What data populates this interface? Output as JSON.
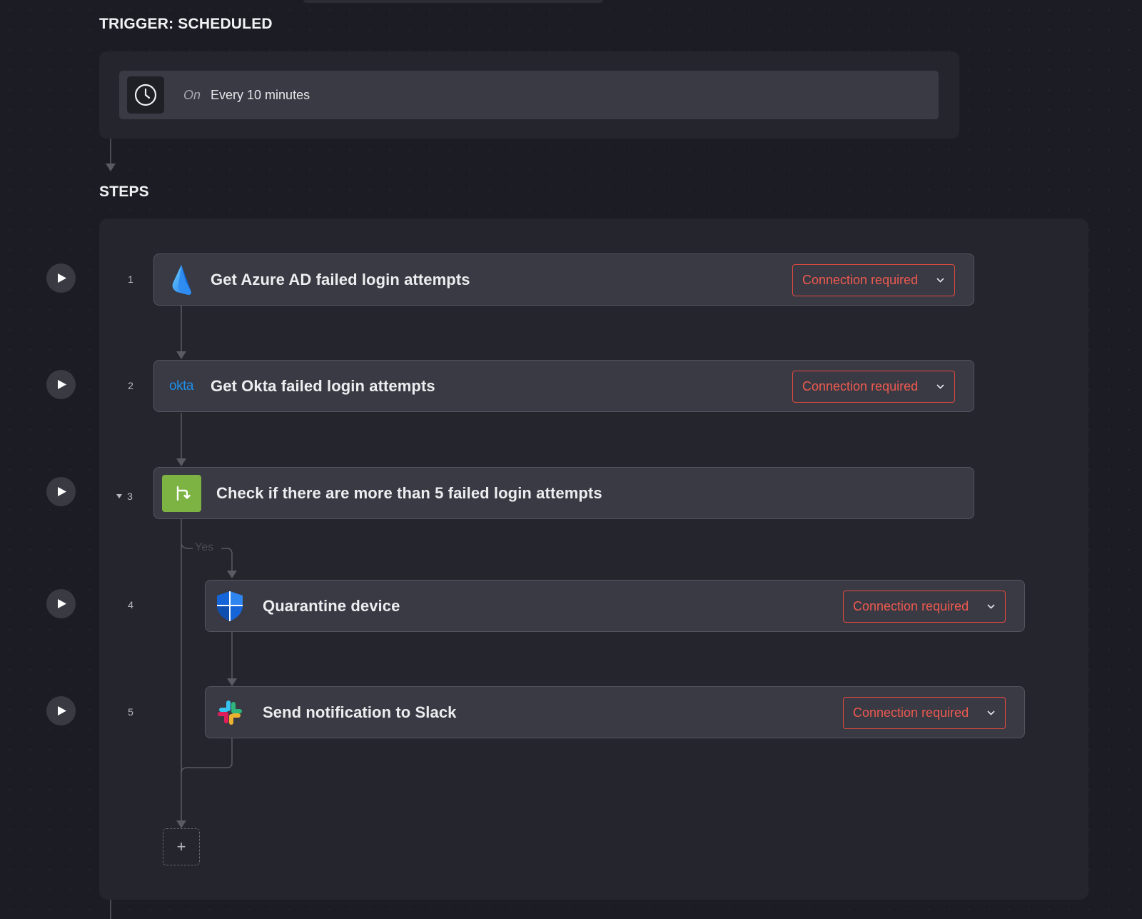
{
  "trigger": {
    "title": "TRIGGER: SCHEDULED",
    "icon": "clock-icon",
    "on_label": "On",
    "schedule": "Every 10 minutes"
  },
  "steps_title": "STEPS",
  "steps": [
    {
      "number": "1",
      "title": "Get Azure AD failed login attempts",
      "icon": "azure-ad-icon",
      "connection": "Connection required"
    },
    {
      "number": "2",
      "title": "Get Okta failed login attempts",
      "icon": "okta-logo-icon",
      "connection": "Connection required"
    },
    {
      "number": "3",
      "title": "Check if there are more than 5 failed login attempts",
      "icon": "branch-condition-icon"
    },
    {
      "number": "4",
      "title": "Quarantine device",
      "icon": "defender-shield-icon",
      "connection": "Connection required"
    },
    {
      "number": "5",
      "title": "Send notification to Slack",
      "icon": "slack-icon",
      "connection": "Connection required"
    }
  ],
  "branch_label": "Yes",
  "okta_wordmark": "okta",
  "add_step_label": "+",
  "colors": {
    "background": "#1c1c24",
    "panel": "#25252d",
    "card": "#3a3a44",
    "warning": "#ee5a4f",
    "condition": "#7cb342"
  }
}
